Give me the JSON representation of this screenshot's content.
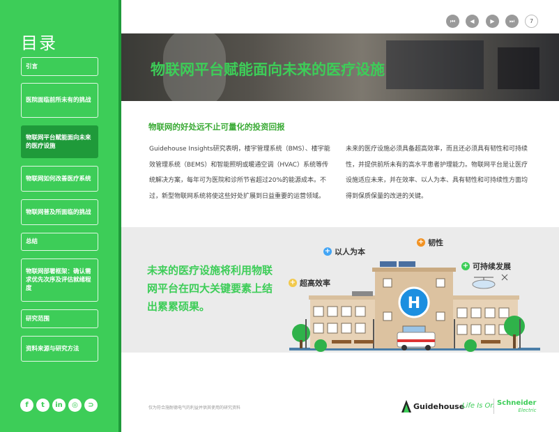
{
  "sidebar": {
    "title": "目录",
    "items": [
      {
        "label": "引言"
      },
      {
        "label": "医院面临前所未有的挑战"
      },
      {
        "label": "物联网平台赋能面向未来的医疗设施"
      },
      {
        "label": "物联网如何改善医疗系统"
      },
      {
        "label": "物联网普及所面临的挑战"
      },
      {
        "label": "总结"
      },
      {
        "label": "物联网部署框架：确认需求优先次序及评估就绪程度"
      },
      {
        "label": "研究范围"
      },
      {
        "label": "资料来源与研究方法"
      }
    ],
    "social": [
      {
        "icon": "facebook-icon",
        "glyph": "f"
      },
      {
        "icon": "twitter-icon",
        "glyph": "t"
      },
      {
        "icon": "linkedin-icon",
        "glyph": "in"
      },
      {
        "icon": "instagram-icon",
        "glyph": "◎"
      },
      {
        "icon": "rss-icon",
        "glyph": "⊃"
      }
    ]
  },
  "nav": {
    "first": "⏮",
    "prev": "◀",
    "next": "▶",
    "last": "⏭",
    "page": "7"
  },
  "hero": {
    "title": "物联网平台赋能面向未来的医疗设施"
  },
  "content": {
    "subheading": "物联网的好处远不止可量化的投资回报",
    "left_paragraph": "Guidehouse Insights研究表明，楼宇管理系统（BMS）、楼宇能效管理系统（BEMS）和智能照明或暖通空调（HVAC）系统等传统解决方案，每年可为医院和诊所节省超过20%的能源成本。不过，新型物联网系统将使这些好处扩展到日益重要的运营领域。",
    "right_paragraph": "未来的医疗设施必须具备超高效率，而且还必须具有韧性和可持续性，并提供前所未有的高水平患者护理能力。物联网平台是让医疗设施适应未来，并在效率、以人为本、具有韧性和可持续性方面均得到保质保量的改进的关键。"
  },
  "band": {
    "text": "未来的医疗设施将利用物联网平台在四大关键要素上结出累累硕果。",
    "tags": [
      {
        "label": "以人为本",
        "color": "#42a5f5"
      },
      {
        "label": "韧性",
        "color": "#f29222"
      },
      {
        "label": "超高效率",
        "color": "#f2c94c"
      },
      {
        "label": "可持续发展",
        "color": "#3dcd58"
      }
    ],
    "hospital_sign": "H"
  },
  "footer": {
    "note": "仅为符合施耐德电气的利益并供其使用的研究资料",
    "guidehouse": "Guidehouse",
    "life_is_on": "Life Is On",
    "schneider": "Schneider",
    "electric": "Electric"
  },
  "colors": {
    "brand_green": "#3dcd58",
    "dark_green": "#1f9a3a"
  }
}
